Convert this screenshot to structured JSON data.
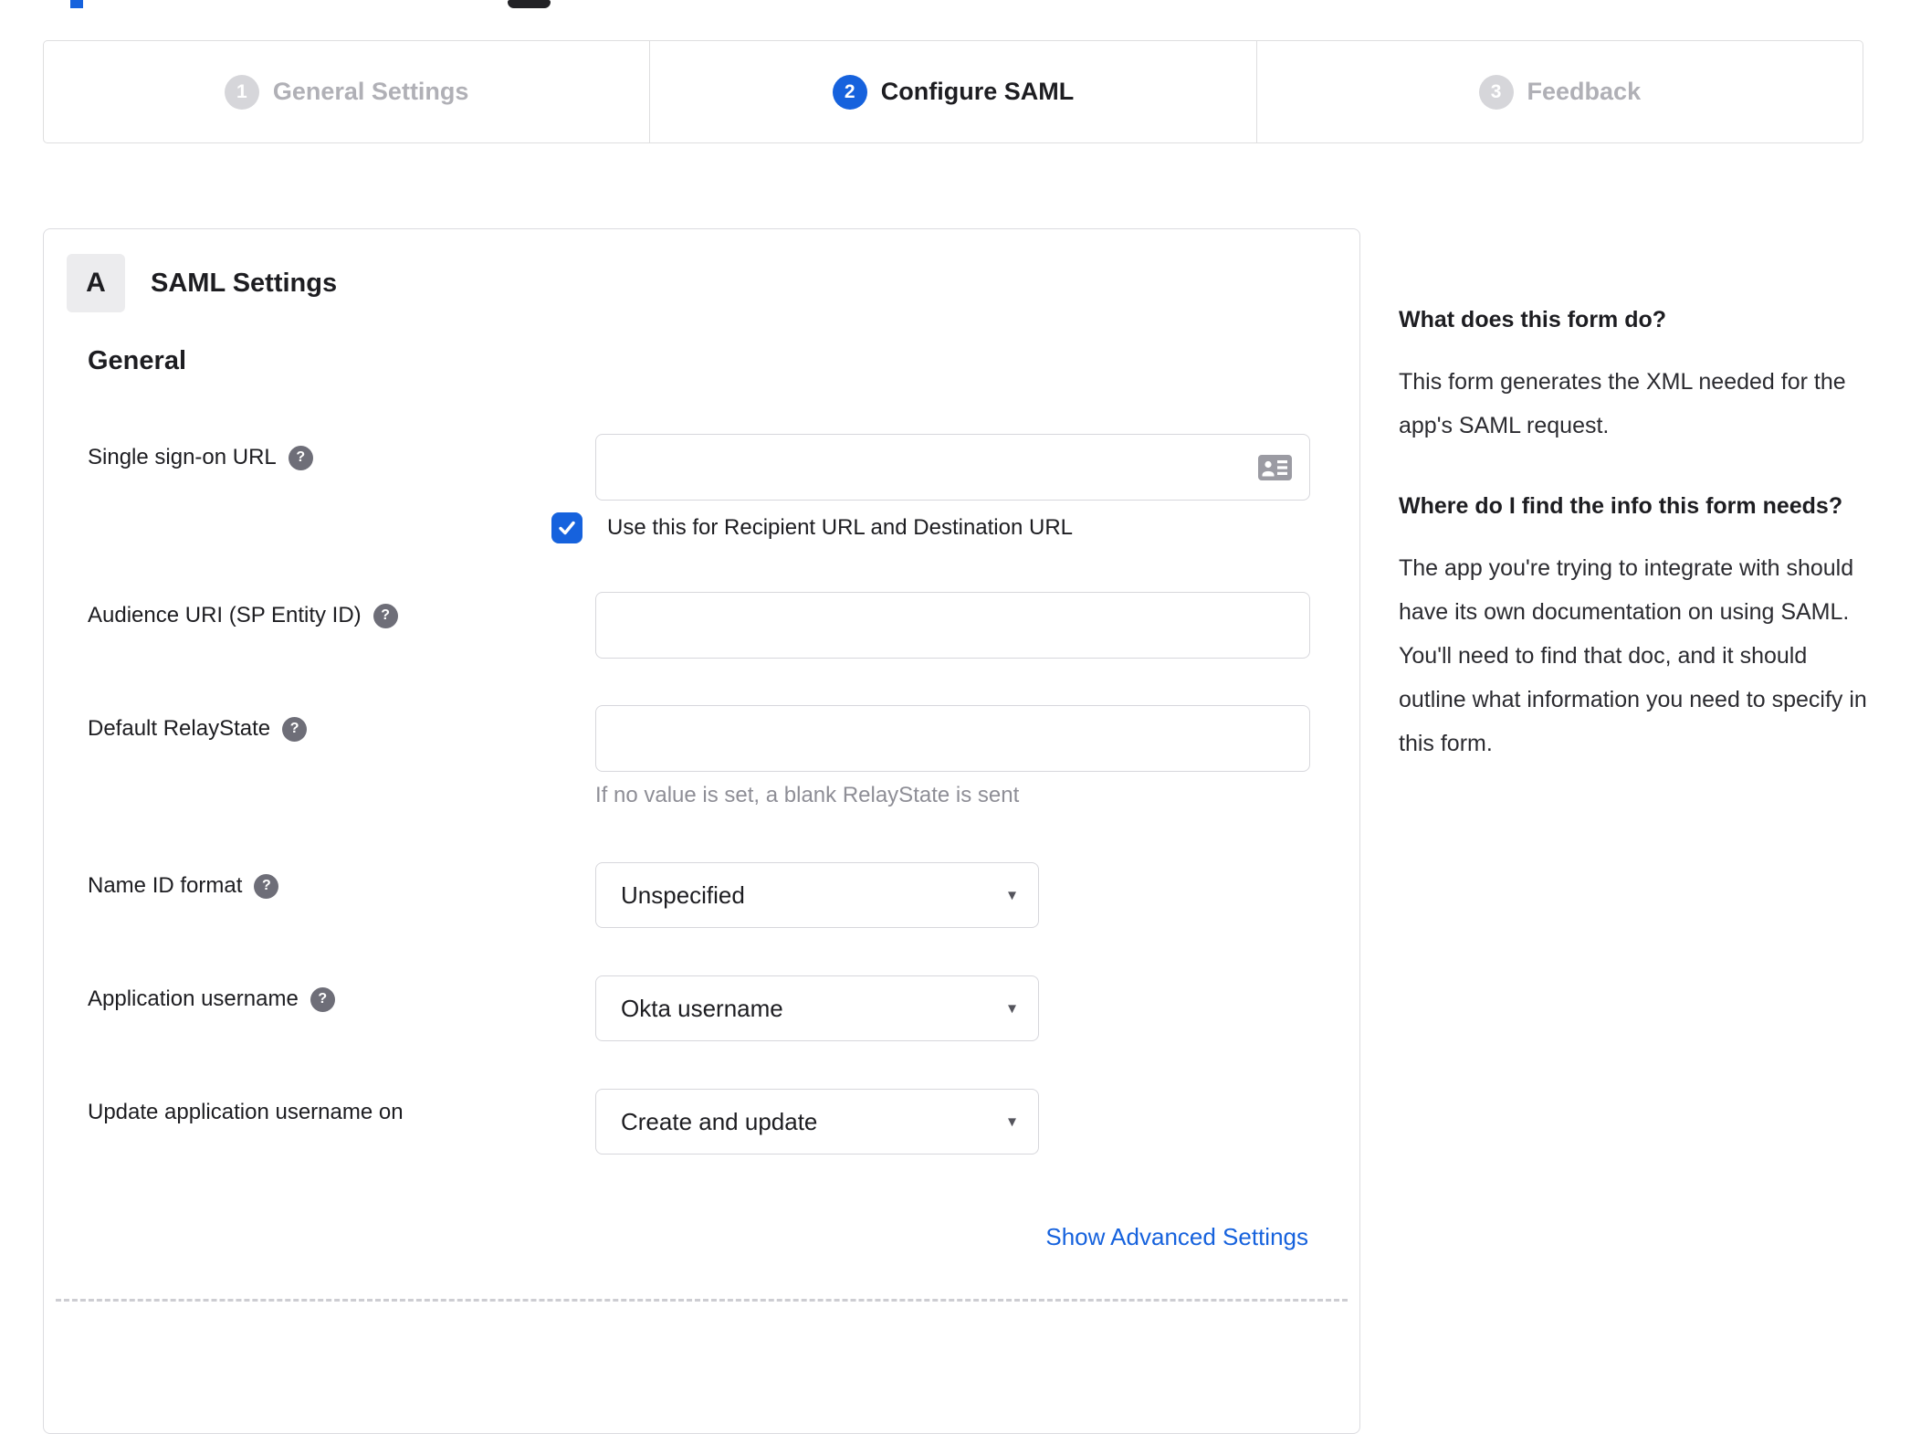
{
  "stepper": {
    "steps": [
      {
        "number": "1",
        "label": "General Settings",
        "state": "inactive"
      },
      {
        "number": "2",
        "label": "Configure SAML",
        "state": "active"
      },
      {
        "number": "3",
        "label": "Feedback",
        "state": "inactive"
      }
    ]
  },
  "panel": {
    "section_badge": "A",
    "section_title": "SAML Settings",
    "group_title": "General",
    "fields": [
      {
        "label": "Single sign-on URL",
        "value": "",
        "checkbox_label": "Use this for Recipient URL and Destination URL",
        "checkbox_checked": true
      },
      {
        "label": "Audience URI (SP Entity ID)",
        "value": ""
      },
      {
        "label": "Default RelayState",
        "value": "",
        "helper": "If no value is set, a blank RelayState is sent"
      },
      {
        "label": "Name ID format",
        "value": "Unspecified"
      },
      {
        "label": "Application username",
        "value": "Okta username"
      },
      {
        "label": "Update application username on",
        "value": "Create and update"
      }
    ],
    "advanced_link": "Show Advanced Settings"
  },
  "sidebar": {
    "sections": [
      {
        "heading": "What does this form do?",
        "body": "This form generates the XML needed for the app's SAML request."
      },
      {
        "heading": "Where do I find the info this form needs?",
        "body": "The app you're trying to integrate with should have its own documentation on using SAML. You'll need to find that doc, and it should outline what information you need to specify in this form."
      }
    ]
  },
  "icons": {
    "help": "?",
    "dropdown_arrow": "▾"
  },
  "colors": {
    "accent_blue": "#1662dd",
    "text_dark": "#1d1d21",
    "muted_gray": "#8e8e96",
    "border": "#d7d7dc"
  }
}
